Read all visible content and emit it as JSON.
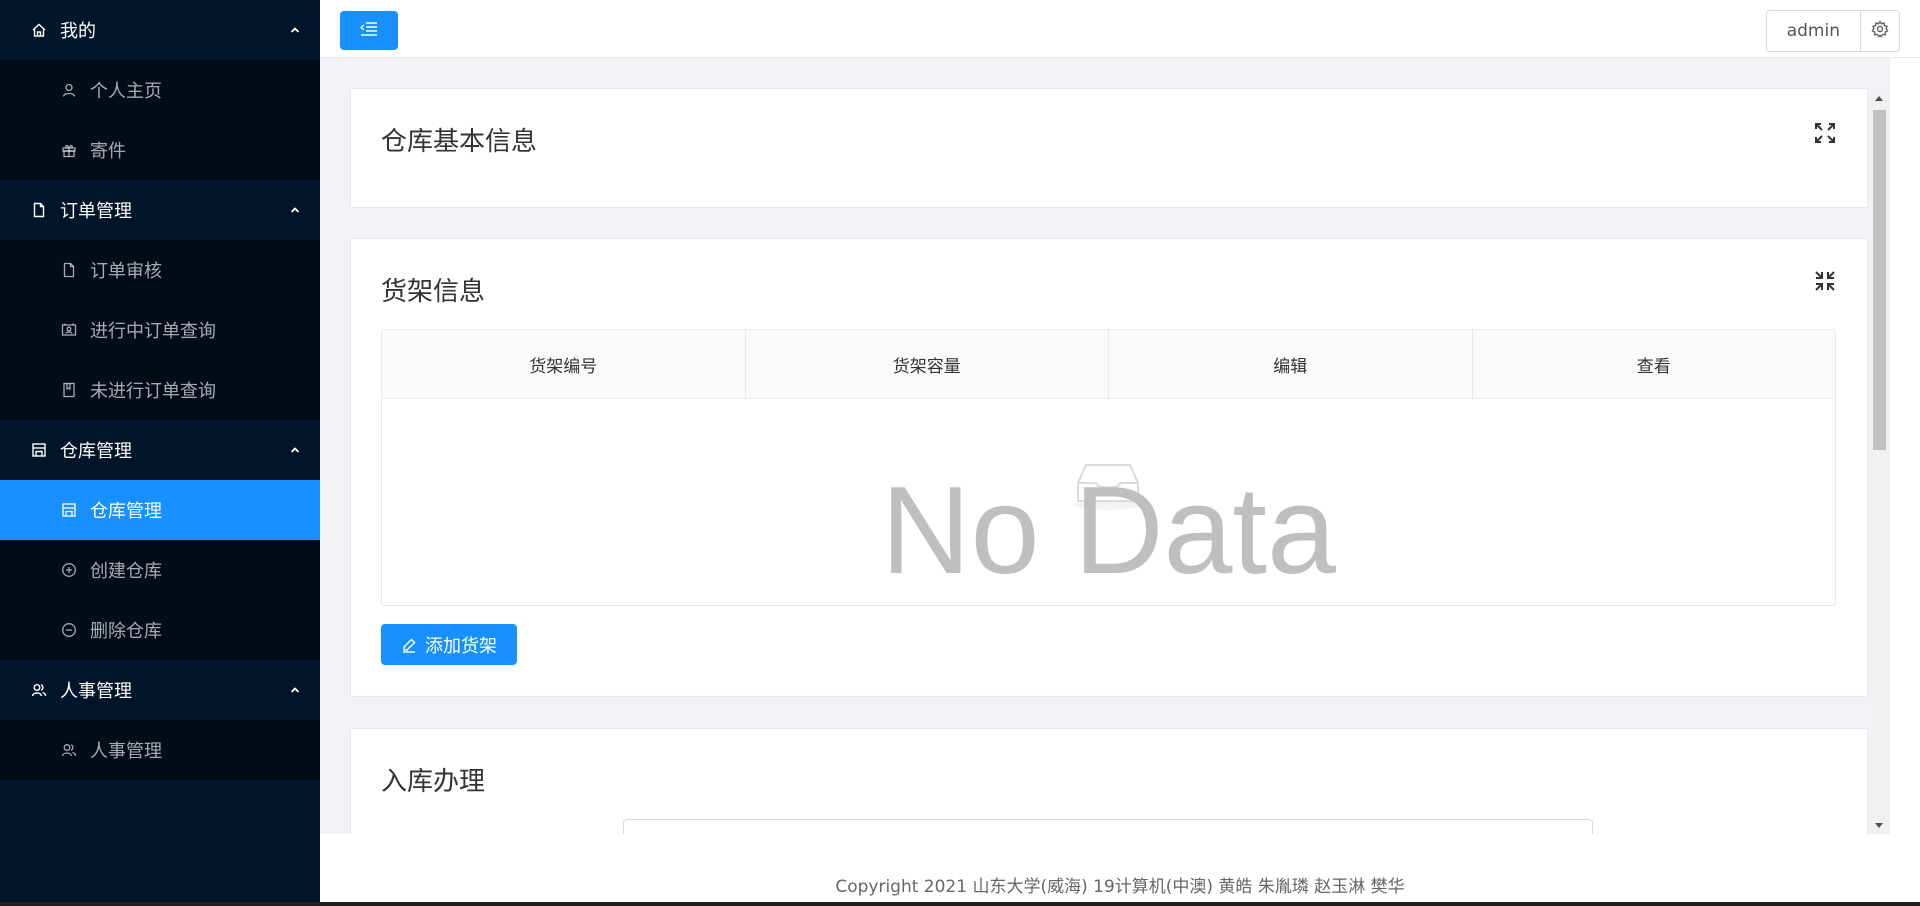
{
  "sidebar": {
    "groups": [
      {
        "label": "我的",
        "icon": "home-icon",
        "items": [
          {
            "label": "个人主页",
            "icon": "user-icon"
          },
          {
            "label": "寄件",
            "icon": "gift-icon"
          }
        ]
      },
      {
        "label": "订单管理",
        "icon": "file-icon",
        "items": [
          {
            "label": "订单审核",
            "icon": "file-icon"
          },
          {
            "label": "进行中订单查询",
            "icon": "contacts-icon"
          },
          {
            "label": "未进行订单查询",
            "icon": "book-icon"
          }
        ]
      },
      {
        "label": "仓库管理",
        "icon": "shop-icon",
        "items": [
          {
            "label": "仓库管理",
            "icon": "shop-icon",
            "active": true
          },
          {
            "label": "创建仓库",
            "icon": "plus-circle-icon"
          },
          {
            "label": "删除仓库",
            "icon": "minus-circle-icon"
          }
        ]
      },
      {
        "label": "人事管理",
        "icon": "team-icon",
        "items": [
          {
            "label": "人事管理",
            "icon": "team-icon"
          }
        ]
      }
    ]
  },
  "header": {
    "user": "admin",
    "menu_toggle_icon": "menu-fold-icon",
    "settings_icon": "settings-icon"
  },
  "cards": {
    "warehouse_info": {
      "title": "仓库基本信息",
      "toggle_icon": "fullscreen-icon"
    },
    "shelf_info": {
      "title": "货架信息",
      "toggle_icon": "fullscreen-exit-icon",
      "table": {
        "columns": [
          "货架编号",
          "货架容量",
          "编辑",
          "查看"
        ],
        "empty_text": "No Data"
      },
      "add_button": "添加货架"
    },
    "inbound": {
      "title": "入库办理"
    }
  },
  "footer": {
    "text": "Copyright 2021 山东大学(威海) 19计算机(中澳) 黄皓 朱胤璘 赵玉淋 樊华"
  },
  "colors": {
    "sidebar_bg": "#001529",
    "submenu_bg": "#000c17",
    "primary": "#1890ff"
  }
}
